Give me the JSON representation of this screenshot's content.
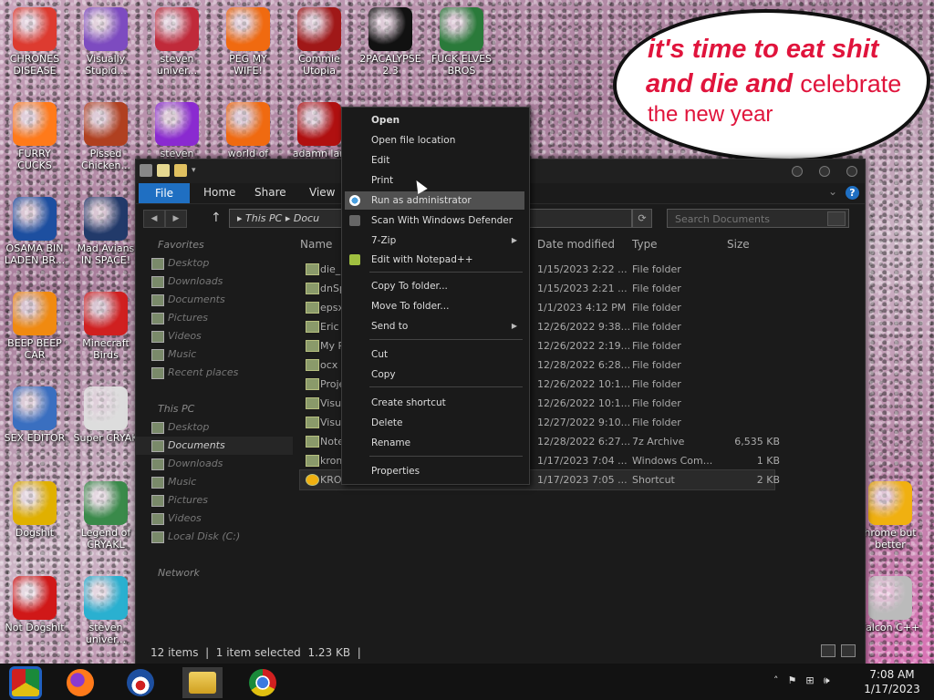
{
  "desktop": {
    "icons": [
      {
        "label": "CHRONES DISEASE",
        "icon": "chrome-icon",
        "color": "#dd3b30"
      },
      {
        "label": "Visually Stupid...",
        "icon": "visual-studio-icon",
        "color": "#7d4bc0"
      },
      {
        "label": "steven univer...",
        "icon": "steven-universe-icon",
        "color": "#c02a3a"
      },
      {
        "label": "PEG MY WIFE!",
        "icon": "peggle-icon",
        "color": "#f06a10"
      },
      {
        "label": "Commie Utopia",
        "icon": "commie-icon",
        "color": "#a01818"
      },
      {
        "label": "2PACALYPSE 2.3",
        "icon": "cmd-icon",
        "color": "#111111"
      },
      {
        "label": "FUCK ELVES BROS",
        "icon": "elf-icon",
        "color": "#2a7a3a"
      },
      {
        "label": "FURRY CUCKS",
        "icon": "firefox-icon",
        "color": "#ff7a1a"
      },
      {
        "label": "Pissed Chicken...",
        "icon": "angry-birds-seasons-icon",
        "color": "#b04020"
      },
      {
        "label": "steven",
        "icon": "gem-icon",
        "color": "#8a2ad0"
      },
      {
        "label": "world of",
        "icon": "peggle-icon",
        "color": "#f06a10"
      },
      {
        "label": "adamn lan",
        "icon": "flash-icon",
        "color": "#b01010"
      },
      {
        "label": "OSAMA BIN LADEN BR...",
        "icon": "obama-icon",
        "color": "#1d4fa0"
      },
      {
        "label": "Mad Avians IN SPACE!",
        "icon": "angry-birds-space-icon",
        "color": "#223a6a"
      },
      {
        "label": "BEEP BEEP CAR",
        "icon": "vlc-icon",
        "color": "#f08a10"
      },
      {
        "label": "Minecraft Birds",
        "icon": "angry-bird-icon",
        "color": "#d02020"
      },
      {
        "label": "SEX EDITOR",
        "icon": "hxd-icon",
        "color": "#3a6fc0"
      },
      {
        "label": "Super CRYAK",
        "icon": "pixel-char-icon",
        "color": "#dddddd"
      },
      {
        "label": "Dogshit",
        "icon": "dogshit-icon",
        "color": "#e0b000"
      },
      {
        "label": "Legend of CRYAKL",
        "icon": "legend-icon",
        "color": "#3a8a4a"
      },
      {
        "label": "Not Dogshit",
        "icon": "devcpp-icon",
        "color": "#d01818"
      },
      {
        "label": "steven univer...",
        "icon": "diamond-icon",
        "color": "#2ab0d0"
      },
      {
        "label": "hrome but better",
        "icon": "chrome-gold-icon",
        "color": "#f0b010"
      },
      {
        "label": "Falcon C++",
        "icon": "recycle-bin-icon",
        "color": "#bbbbbb"
      }
    ],
    "banner": {
      "line1": "it's time to eat shit",
      "line2a": "and die and",
      "line2b": "celebrate",
      "line3": "the new year"
    }
  },
  "explorer": {
    "ribbon_tabs": {
      "file": "File",
      "home": "Home",
      "share": "Share",
      "view": "View",
      "help": "?"
    },
    "address": {
      "this_pc": "This PC",
      "docs": "Docu"
    },
    "search_placeholder": "Search Documents",
    "nav": {
      "favorites": "Favorites",
      "fav_items": [
        "Desktop",
        "Downloads",
        "Documents",
        "Pictures",
        "Videos",
        "Music",
        "Recent places"
      ],
      "this_pc": "This PC",
      "pc_items": [
        "Desktop",
        "Documents",
        "Downloads",
        "Music",
        "Pictures",
        "Videos",
        "Local Disk (C:)"
      ],
      "network": "Network"
    },
    "columns": {
      "name": "Name",
      "date": "Date modified",
      "type": "Type",
      "size": "Size"
    },
    "rows": [
      {
        "name": "die_",
        "date": "1/15/2023 2:22 ...",
        "type": "File folder",
        "size": ""
      },
      {
        "name": "dnSp",
        "date": "1/15/2023 2:21 ...",
        "type": "File folder",
        "size": ""
      },
      {
        "name": "epsx",
        "date": "1/1/2023 4:12 PM",
        "type": "File folder",
        "size": ""
      },
      {
        "name": "Eric (",
        "date": "12/26/2022 9:38...",
        "type": "File folder",
        "size": ""
      },
      {
        "name": "My R",
        "date": "12/26/2022 2:19...",
        "type": "File folder",
        "size": ""
      },
      {
        "name": "ocx",
        "date": "12/28/2022 6:28...",
        "type": "File folder",
        "size": ""
      },
      {
        "name": "Proje",
        "date": "12/26/2022 10:1...",
        "type": "File folder",
        "size": ""
      },
      {
        "name": "Visu",
        "date": "12/26/2022 10:1...",
        "type": "File folder",
        "size": ""
      },
      {
        "name": "Visu",
        "date": "12/27/2022 9:10...",
        "type": "File folder",
        "size": ""
      },
      {
        "name": "Note",
        "date": "12/28/2022 6:27...",
        "type": "7z Archive",
        "size": "6,535 KB"
      },
      {
        "name": "krom",
        "date": "1/17/2023 7:04 ...",
        "type": "Windows Com...",
        "size": "1 KB"
      },
      {
        "name": "KROM",
        "date": "1/17/2023 7:05 ...",
        "type": "Shortcut",
        "size": "2 KB"
      }
    ],
    "status": {
      "items": "12 items",
      "selected": "1 item selected",
      "size": "1.23 KB"
    }
  },
  "context_menu": {
    "items": [
      {
        "label": "Open",
        "bold": true
      },
      {
        "label": "Open file location"
      },
      {
        "label": "Edit"
      },
      {
        "label": "Print"
      },
      {
        "label": "Run as administrator",
        "highlight": true,
        "icon": "shield-icon"
      },
      {
        "label": "Scan With Windows Defender",
        "icon": "defender-icon"
      },
      {
        "label": "7-Zip",
        "submenu": true
      },
      {
        "label": "Edit with Notepad++",
        "icon": "notepadpp-icon"
      },
      {
        "label": "Copy To folder..."
      },
      {
        "label": "Move To folder..."
      },
      {
        "label": "Send to",
        "submenu": true
      },
      {
        "label": "Cut"
      },
      {
        "label": "Copy"
      },
      {
        "label": "Create shortcut"
      },
      {
        "label": "Delete"
      },
      {
        "label": "Rename"
      },
      {
        "label": "Properties"
      }
    ]
  },
  "taskbar": {
    "time": "7:08 AM",
    "date": "1/17/2023",
    "pinned": [
      "chrome-alt-icon",
      "firefox-icon",
      "obama-icon",
      "file-explorer-icon",
      "chrome-icon"
    ]
  }
}
